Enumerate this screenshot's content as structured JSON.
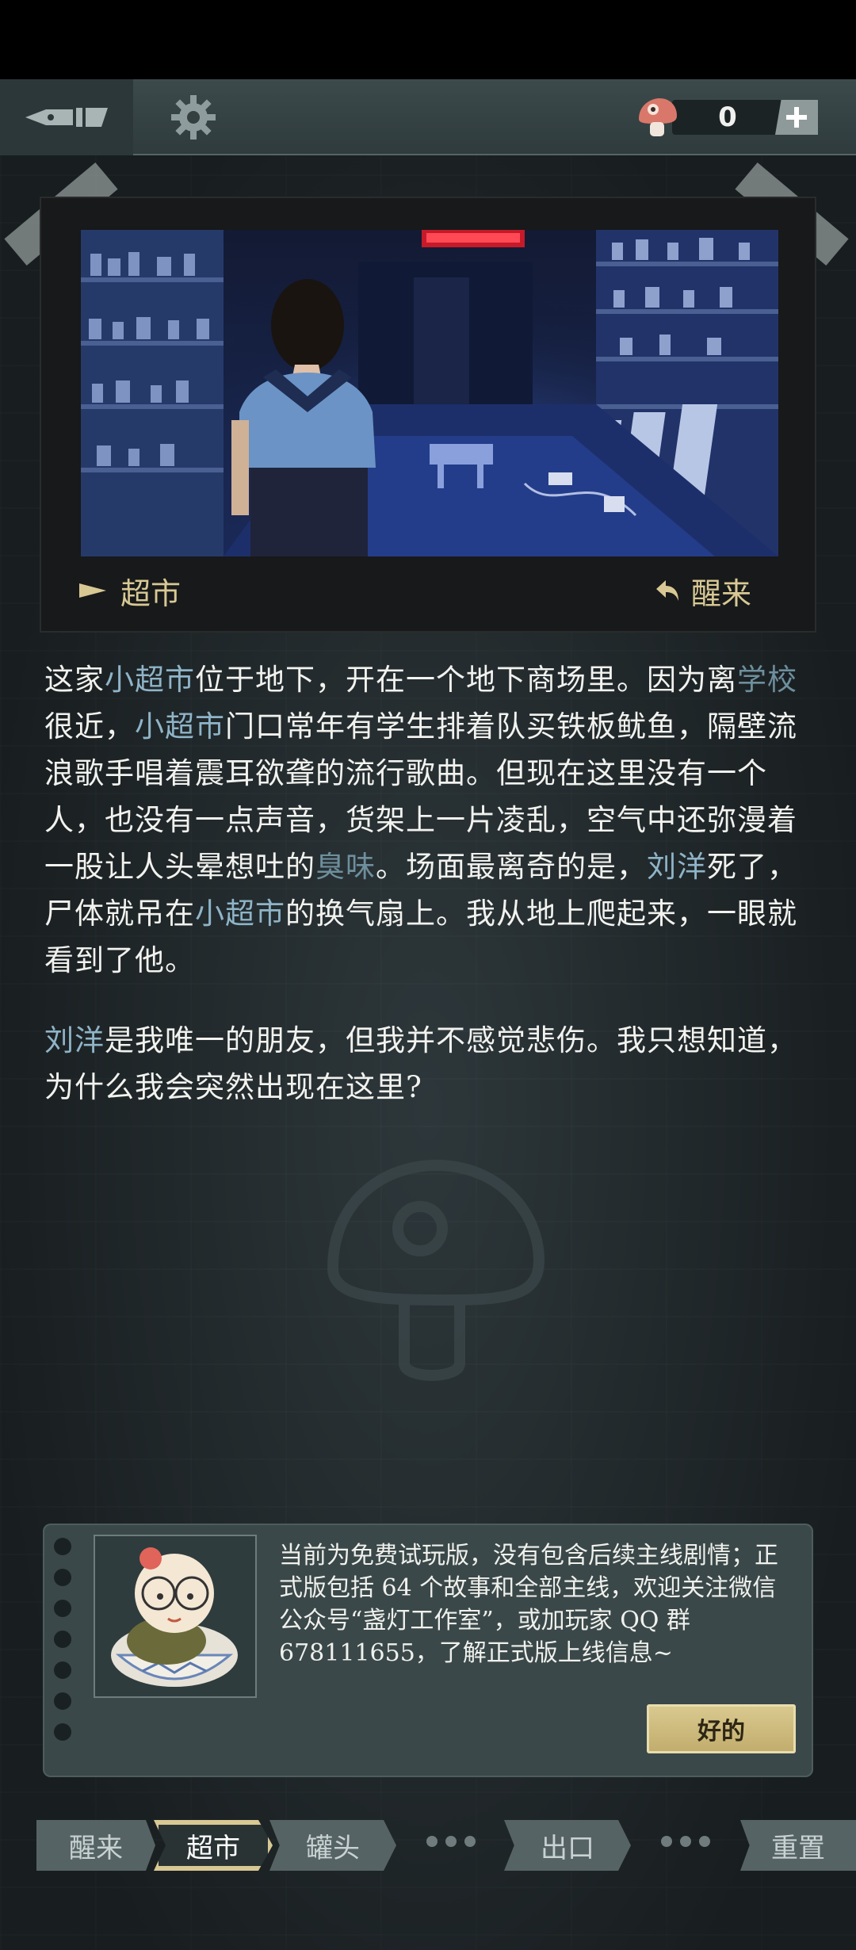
{
  "topbar": {
    "pen_icon": "pen-nib-icon",
    "gear_icon": "gear-icon",
    "mushroom_icon": "mushroom-icon",
    "plus_icon": "plus-icon",
    "mushroom_count": "0"
  },
  "scene": {
    "location_label": "超市",
    "action_label": "醒来",
    "flag_icon": "flag-icon",
    "return_icon": "return-arrow-icon"
  },
  "story": {
    "paragraph1": [
      {
        "text": "这家",
        "hl": false
      },
      {
        "text": "小超市",
        "hl": true
      },
      {
        "text": "位于地下，开在一个地下商场里。因为离",
        "hl": false
      },
      {
        "text": "学校",
        "hl": "dim"
      },
      {
        "text": "很近，",
        "hl": false
      },
      {
        "text": "小超市",
        "hl": true
      },
      {
        "text": "门口常年有学生排着队买铁板鱿鱼，隔壁流浪歌手唱着震耳欲聋的流行歌曲。但现在这里没有一个人，也没有一点声音，货架上一片凌乱，空气中还弥漫着一股让人头晕想吐的",
        "hl": false
      },
      {
        "text": "臭味",
        "hl": "dim"
      },
      {
        "text": "。场面最离奇的是，",
        "hl": false
      },
      {
        "text": "刘洋",
        "hl": true
      },
      {
        "text": "死了，尸体就吊在",
        "hl": false
      },
      {
        "text": "小超市",
        "hl": true
      },
      {
        "text": "的换气扇上。我从地上爬起来，一眼就看到了他。",
        "hl": false
      }
    ],
    "paragraph2": [
      {
        "text": "刘洋",
        "hl": true
      },
      {
        "text": "是我唯一的朋友，但我并不感觉悲伤。我只想知道，为什么我会突然出现在这里?",
        "hl": false
      }
    ]
  },
  "notice": {
    "text": "当前为免费试玩版，没有包含后续主线剧情；正式版包括 64 个故事和全部主线，欢迎关注微信公众号“盏灯工作室”，或加玩家 QQ 群 678111655，了解正式版上线信息~",
    "ok_label": "好的"
  },
  "nav": {
    "tabs": [
      "醒来",
      "超市",
      "罐头",
      "出口",
      "重置"
    ],
    "active_index": 1
  },
  "colors": {
    "accent_gold": "#d8c894",
    "highlight_blue": "#8fb4c8",
    "panel": "#3a4849"
  }
}
